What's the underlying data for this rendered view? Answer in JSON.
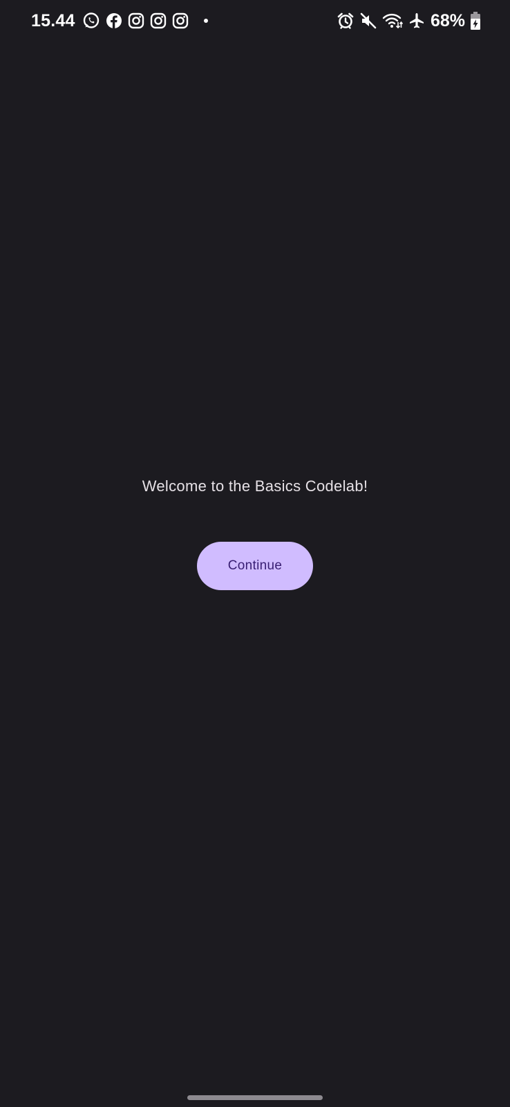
{
  "status_bar": {
    "time": "15.44",
    "notification_icons": [
      "whatsapp-icon",
      "facebook-icon",
      "instagram-icon",
      "instagram-icon",
      "instagram-icon",
      "more-dot-icon"
    ],
    "system_icons": [
      "alarm-icon",
      "mute-icon",
      "wifi-icon",
      "airplane-icon"
    ],
    "battery_percent": "68%",
    "battery_state": "charging"
  },
  "main": {
    "welcome_text": "Welcome to the Basics Codelab!",
    "continue_label": "Continue"
  },
  "colors": {
    "background": "#1c1b20",
    "button_bg": "#d0bcff",
    "button_text": "#381e72",
    "text": "#e6e1e6"
  }
}
